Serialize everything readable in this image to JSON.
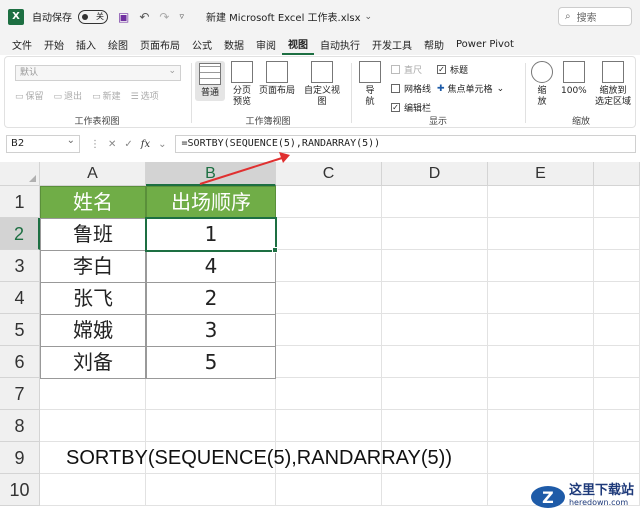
{
  "titlebar": {
    "autosave_label": "自动保存",
    "autosave_state": "关",
    "filename": "新建 Microsoft Excel 工作表.xlsx",
    "search_placeholder": "搜索"
  },
  "menu": {
    "tabs": [
      "文件",
      "开始",
      "插入",
      "绘图",
      "页面布局",
      "公式",
      "数据",
      "审阅",
      "视图",
      "自动执行",
      "开发工具",
      "帮助",
      "Power Pivot"
    ],
    "active_index": 8
  },
  "ribbon": {
    "sheetview": {
      "dropdown_value": "默认",
      "buttons": [
        "保留",
        "退出",
        "新建",
        "选项"
      ],
      "label": "工作表视图"
    },
    "workbookview": {
      "buttons": [
        {
          "line1": "普通",
          "line2": ""
        },
        {
          "line1": "分页",
          "line2": "预览"
        },
        {
          "line1": "页面布局",
          "line2": ""
        },
        {
          "line1": "自定义视图",
          "line2": ""
        }
      ],
      "label": "工作簿视图"
    },
    "show": {
      "nav_line1": "导",
      "nav_line2": "航",
      "checks": [
        {
          "label": "直尺",
          "checked": false,
          "dim": true
        },
        {
          "label": "标题",
          "checked": true,
          "dim": false
        },
        {
          "label": "网格线",
          "checked": false,
          "dim": false
        },
        {
          "label": "焦点单元格",
          "checked": false,
          "dim": false
        },
        {
          "label": "编辑栏",
          "checked": true,
          "dim": false
        }
      ],
      "label": "显示"
    },
    "zoom": {
      "buttons": [
        {
          "line1": "缩",
          "line2": "放"
        },
        {
          "line1": "100%",
          "line2": ""
        },
        {
          "line1": "缩放到",
          "line2": "选定区域"
        }
      ],
      "label": "缩放"
    }
  },
  "formula_bar": {
    "name_box": "B2",
    "formula": "=SORTBY(SEQUENCE(5),RANDARRAY(5))"
  },
  "sheet": {
    "columns": [
      "A",
      "B",
      "C",
      "D",
      "E"
    ],
    "rows": [
      "1",
      "2",
      "3",
      "4",
      "5",
      "6",
      "7",
      "8",
      "9",
      "10"
    ],
    "header": [
      "姓名",
      "出场顺序"
    ],
    "data": [
      [
        "鲁班",
        "1"
      ],
      [
        "李白",
        "4"
      ],
      [
        "张飞",
        "2"
      ],
      [
        "嫦娥",
        "3"
      ],
      [
        "刘备",
        "5"
      ]
    ],
    "annotation": "SORTBY(SEQUENCE(5),RANDARRAY(5))"
  },
  "watermark": {
    "logo": "Z",
    "line1": "这里下载站",
    "line2": "heredown.com"
  },
  "colors": {
    "excel_green": "#1d6f42",
    "header_green": "#70ad47",
    "arrow_red": "#e03030"
  }
}
